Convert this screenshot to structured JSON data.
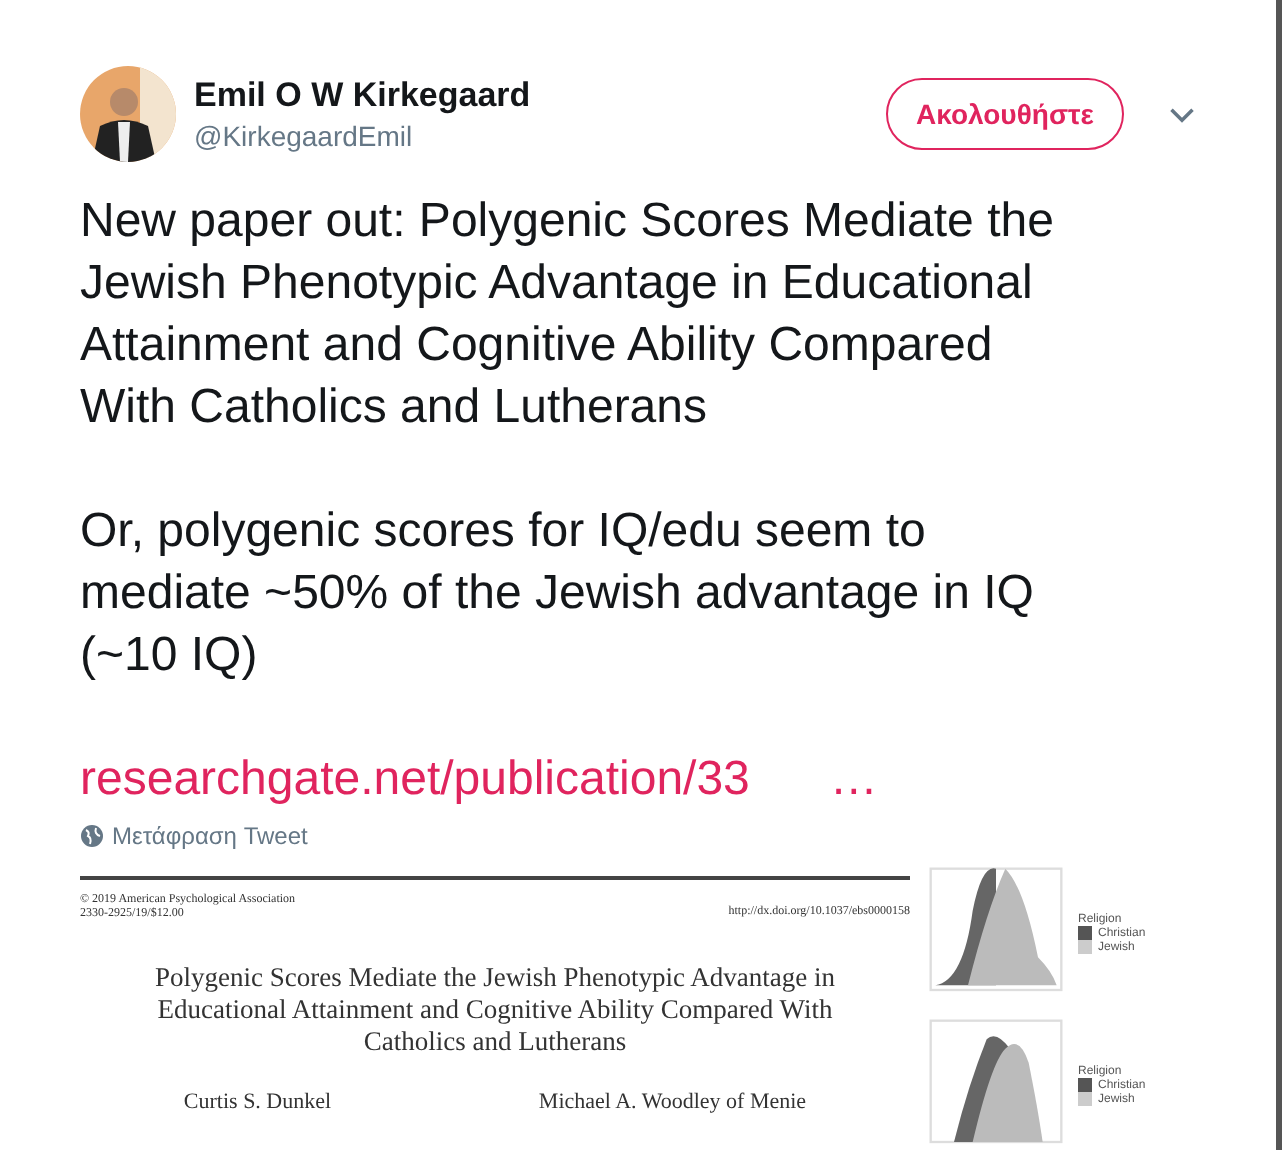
{
  "author": {
    "name": "Emil O W Kirkegaard",
    "handle": "@KirkegaardEmil"
  },
  "follow_button": "Ακολουθήστε",
  "tweet": {
    "paragraphs": [
      [
        "New paper out: Polygenic Scores Mediate the",
        "Jewish Phenotypic Advantage in Educational",
        "Attainment and Cognitive Ability Compared",
        "With Catholics and Lutherans"
      ],
      [
        "Or, polygenic scores for IQ/edu seem to",
        "mediate ~50% of the Jewish advantage in IQ",
        "(~10 IQ)"
      ]
    ],
    "link": "researchgate.net/publication/33",
    "link_ellipsis": "…",
    "translate": "Μετάφραση Tweet"
  },
  "attachment": {
    "paper": {
      "copyright": "© 2019 American Psychological Association",
      "issn": "2330-2925/19/$12.00",
      "doi": "http://dx.doi.org/10.1037/ebs0000158",
      "title_lines": [
        "Polygenic Scores Mediate the Jewish Phenotypic Advantage in",
        "Educational Attainment and Cognitive Ability Compared With",
        "Catholics and Lutherans"
      ],
      "authors": [
        "Curtis S. Dunkel",
        "Michael A. Woodley of Menie"
      ]
    },
    "legends": [
      {
        "title": "Religion",
        "items": [
          {
            "label": "Christian",
            "color": "#555555"
          },
          {
            "label": "Jewish",
            "color": "#cccccc"
          }
        ]
      },
      {
        "title": "Religion",
        "items": [
          {
            "label": "Christian",
            "color": "#555555"
          },
          {
            "label": "Jewish",
            "color": "#cccccc"
          }
        ]
      }
    ]
  }
}
